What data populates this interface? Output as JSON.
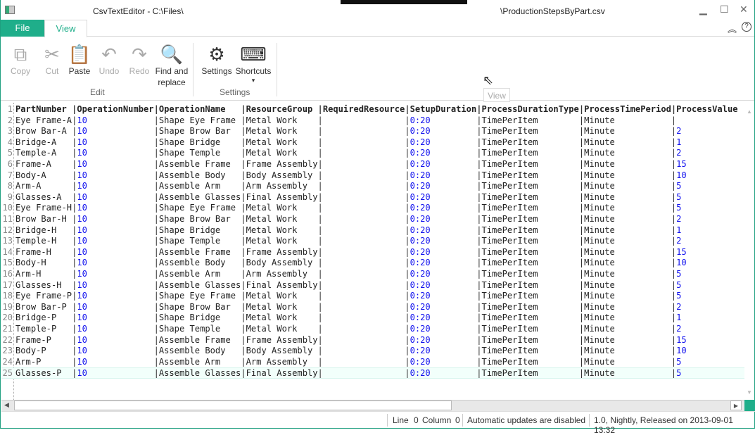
{
  "window": {
    "title_left": "CsvTextEditor - C:\\Files\\",
    "title_right": "\\ProductionStepsByPart.csv",
    "minimize": "▁",
    "maximize": "☐",
    "close": "✕"
  },
  "tabs": [
    {
      "label": "File",
      "active": false
    },
    {
      "label": "View",
      "active": true
    }
  ],
  "ribbon_icons": {
    "collapse": "︽",
    "help": "?"
  },
  "ribbon": {
    "edit_group": "Edit",
    "settings_group": "Settings",
    "buttons": [
      {
        "label": "Copy",
        "icon": "copy-icon",
        "glyph": "⧉",
        "enabled": false
      },
      {
        "label": "Cut",
        "icon": "scissors-icon",
        "glyph": "✂",
        "enabled": false
      },
      {
        "label": "Paste",
        "icon": "paste-icon",
        "glyph": "📋",
        "enabled": true
      },
      {
        "label": "Undo",
        "icon": "undo-icon",
        "glyph": "↶",
        "enabled": false
      },
      {
        "label": "Redo",
        "icon": "redo-icon",
        "glyph": "↷",
        "enabled": false
      },
      {
        "label": "Find and replace",
        "icon": "search-icon",
        "glyph": "🔍",
        "enabled": true
      },
      {
        "label": "Settings",
        "icon": "gear-icon",
        "glyph": "⚙",
        "enabled": true
      },
      {
        "label": "Shortcuts",
        "icon": "keyboard-icon",
        "glyph": "⌨",
        "enabled": true,
        "dropdown": "▾"
      }
    ]
  },
  "tooltip": "View",
  "editor": {
    "columns": [
      "PartNumber",
      "OperationNumber",
      "OperationName",
      "ResourceGroup",
      "RequiredResource",
      "SetupDuration",
      "ProcessDurationType",
      "ProcessTimePeriod",
      "ProcessValue"
    ],
    "rows": [
      [
        "Eye Frame-A",
        "10",
        "Shape Eye Frame",
        "Metal Work",
        "",
        "0:20",
        "TimePerItem",
        "Minute",
        ""
      ],
      [
        "Brow Bar-A",
        "10",
        "Shape Brow Bar",
        "Metal Work",
        "",
        "0:20",
        "TimePerItem",
        "Minute",
        "2"
      ],
      [
        "Bridge-A",
        "10",
        "Shape Bridge",
        "Metal Work",
        "",
        "0:20",
        "TimePerItem",
        "Minute",
        "1"
      ],
      [
        "Temple-A",
        "10",
        "Shape Temple",
        "Metal Work",
        "",
        "0:20",
        "TimePerItem",
        "Minute",
        "2"
      ],
      [
        "Frame-A",
        "10",
        "Assemble Frame",
        "Frame Assembly",
        "",
        "0:20",
        "TimePerItem",
        "Minute",
        "15"
      ],
      [
        "Body-A",
        "10",
        "Assemble Body",
        "Body Assembly",
        "",
        "0:20",
        "TimePerItem",
        "Minute",
        "10"
      ],
      [
        "Arm-A",
        "10",
        "Assemble Arm",
        "Arm Assembly",
        "",
        "0:20",
        "TimePerItem",
        "Minute",
        "5"
      ],
      [
        "Glasses-A",
        "10",
        "Assemble Glasses",
        "Final Assembly",
        "",
        "0:20",
        "TimePerItem",
        "Minute",
        "5"
      ],
      [
        "Eye Frame-H",
        "10",
        "Shape Eye Frame",
        "Metal Work",
        "",
        "0:20",
        "TimePerItem",
        "Minute",
        "5"
      ],
      [
        "Brow Bar-H",
        "10",
        "Shape Brow Bar",
        "Metal Work",
        "",
        "0:20",
        "TimePerItem",
        "Minute",
        "2"
      ],
      [
        "Bridge-H",
        "10",
        "Shape Bridge",
        "Metal Work",
        "",
        "0:20",
        "TimePerItem",
        "Minute",
        "1"
      ],
      [
        "Temple-H",
        "10",
        "Shape Temple",
        "Metal Work",
        "",
        "0:20",
        "TimePerItem",
        "Minute",
        "2"
      ],
      [
        "Frame-H",
        "10",
        "Assemble Frame",
        "Frame Assembly",
        "",
        "0:20",
        "TimePerItem",
        "Minute",
        "15"
      ],
      [
        "Body-H",
        "10",
        "Assemble Body",
        "Body Assembly",
        "",
        "0:20",
        "TimePerItem",
        "Minute",
        "10"
      ],
      [
        "Arm-H",
        "10",
        "Assemble Arm",
        "Arm Assembly",
        "",
        "0:20",
        "TimePerItem",
        "Minute",
        "5"
      ],
      [
        "Glasses-H",
        "10",
        "Assemble Glasses",
        "Final Assembly",
        "",
        "0:20",
        "TimePerItem",
        "Minute",
        "5"
      ],
      [
        "Eye Frame-P",
        "10",
        "Shape Eye Frame",
        "Metal Work",
        "",
        "0:20",
        "TimePerItem",
        "Minute",
        "5"
      ],
      [
        "Brow Bar-P",
        "10",
        "Shape Brow Bar",
        "Metal Work",
        "",
        "0:20",
        "TimePerItem",
        "Minute",
        "2"
      ],
      [
        "Bridge-P",
        "10",
        "Shape Bridge",
        "Metal Work",
        "",
        "0:20",
        "TimePerItem",
        "Minute",
        "1"
      ],
      [
        "Temple-P",
        "10",
        "Shape Temple",
        "Metal Work",
        "",
        "0:20",
        "TimePerItem",
        "Minute",
        "2"
      ],
      [
        "Frame-P",
        "10",
        "Assemble Frame",
        "Frame Assembly",
        "",
        "0:20",
        "TimePerItem",
        "Minute",
        "15"
      ],
      [
        "Body-P",
        "10",
        "Assemble Body",
        "Body Assembly",
        "",
        "0:20",
        "TimePerItem",
        "Minute",
        "10"
      ],
      [
        "Arm-P",
        "10",
        "Assemble Arm",
        "Arm Assembly",
        "",
        "0:20",
        "TimePerItem",
        "Minute",
        "5"
      ],
      [
        "Glasses-P",
        "10",
        "Assemble Glasses",
        "Final Assembly",
        "",
        "0:20",
        "TimePerItem",
        "Minute",
        "5"
      ]
    ],
    "current_line": 25
  },
  "status": {
    "line_label": "Line",
    "line": "0",
    "column_label": "Column",
    "column": "0",
    "updates": "Automatic updates are disabled",
    "version": "1.0, Nightly, Released on 2013-09-01 13:32"
  },
  "colors": {
    "accent": "#1fae8a",
    "number": "#1010ee"
  }
}
